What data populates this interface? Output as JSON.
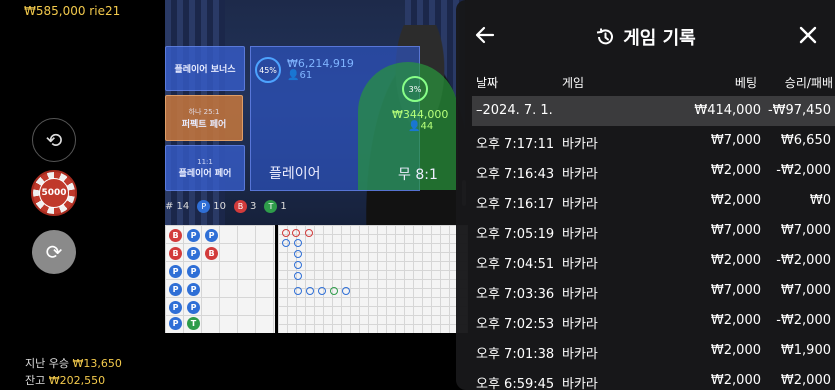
{
  "scene": {
    "top_balance": "₩585,000 rie21",
    "bet_tiles": {
      "player_bonus": "플레이어 보너스",
      "perfect_pair_odds": "하나 25:1",
      "perfect_pair": "퍼펙트 페어",
      "player_pair_odds": "11:1",
      "player_pair": "플레이어 페어"
    },
    "player_zone": {
      "percent": "45%",
      "amount": "₩6,214,919",
      "count": "61",
      "label": "플레이어"
    },
    "tie_zone": {
      "percent": "3%",
      "amount": "₩344,000",
      "count": "44",
      "label": "무 8:1"
    },
    "chip_value": "5000",
    "stats": {
      "hash_label": "# 14",
      "p_label": "P",
      "p_count": "10",
      "b_label": "B",
      "b_count": "3",
      "t_label": "T",
      "t_count": "1"
    },
    "bottom": {
      "last_win_label": "지난 우승",
      "last_win_value": "₩13,650",
      "balance_label": "잔고",
      "balance_value": "₩202,550"
    }
  },
  "panel": {
    "title": "게임 기록",
    "columns": {
      "date": "날짜",
      "game": "게임",
      "bet": "베팅",
      "winloss": "승리/패배"
    },
    "date_row": {
      "date": "–2024. 7. 1.",
      "bet": "₩414,000",
      "winloss": "-₩97,450"
    },
    "rows": [
      {
        "time": "오후 7:17:11",
        "game": "바카라",
        "bet": "₩7,000",
        "winloss": "₩6,650"
      },
      {
        "time": "오후 7:16:43",
        "game": "바카라",
        "bet": "₩2,000",
        "winloss": "-₩2,000"
      },
      {
        "time": "오후 7:16:17",
        "game": "바카라",
        "bet": "₩2,000",
        "winloss": "₩0"
      },
      {
        "time": "오후 7:05:19",
        "game": "바카라",
        "bet": "₩7,000",
        "winloss": "₩7,000"
      },
      {
        "time": "오후 7:04:51",
        "game": "바카라",
        "bet": "₩2,000",
        "winloss": "-₩2,000"
      },
      {
        "time": "오후 7:03:36",
        "game": "바카라",
        "bet": "₩7,000",
        "winloss": "₩7,000"
      },
      {
        "time": "오후 7:02:53",
        "game": "바카라",
        "bet": "₩2,000",
        "winloss": "-₩2,000"
      },
      {
        "time": "오후 7:01:38",
        "game": "바카라",
        "bet": "₩2,000",
        "winloss": "₩1,900"
      },
      {
        "time": "오후 6:59:45",
        "game": "바카라",
        "bet": "₩2,000",
        "winloss": "₩2,000"
      }
    ]
  }
}
